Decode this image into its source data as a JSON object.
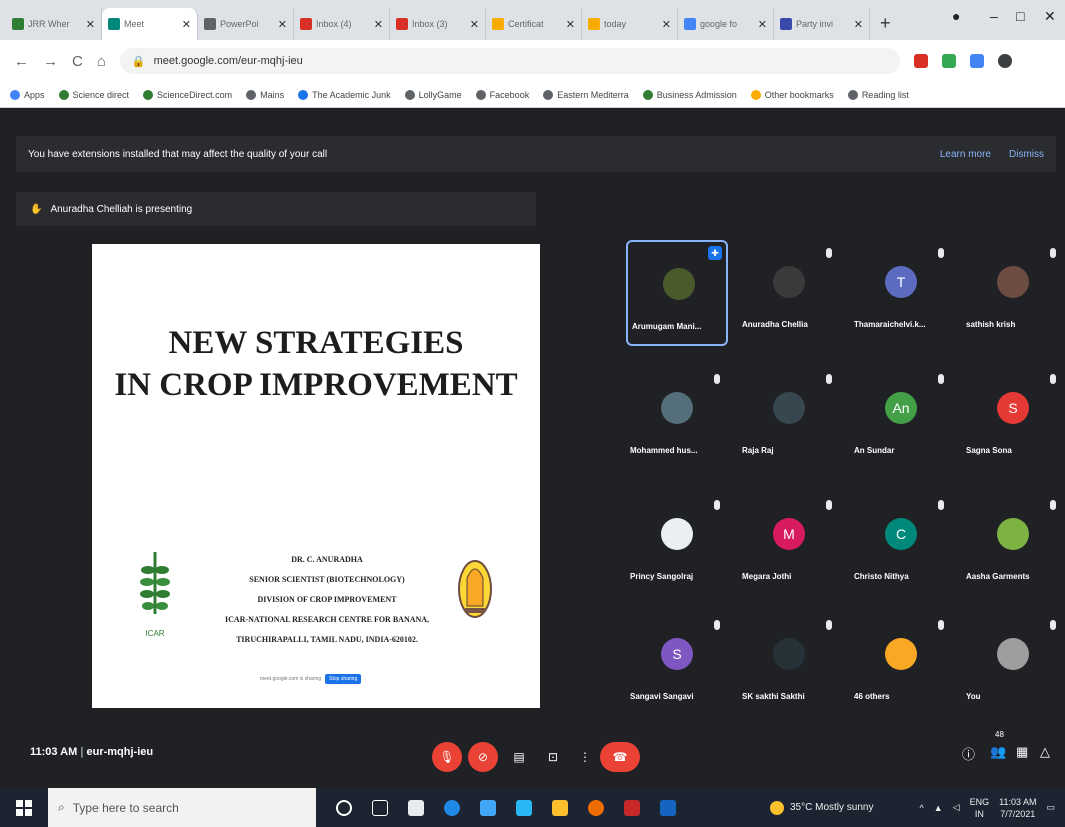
{
  "browser": {
    "tabs": [
      {
        "title": "JRR Wher",
        "color": "#2e7d32"
      },
      {
        "title": "Meet",
        "color": "#00897b",
        "active": true
      },
      {
        "title": "PowerPoi",
        "color": "#5f6368"
      },
      {
        "title": "Inbox (4)",
        "color": "#d93025"
      },
      {
        "title": "Inbox (3)",
        "color": "#d93025"
      },
      {
        "title": "Certificat",
        "color": "#f9ab00"
      },
      {
        "title": "today",
        "color": "#f9ab00"
      },
      {
        "title": "google fo",
        "color": "#4285f4"
      },
      {
        "title": "Party invi",
        "color": "#3949ab"
      }
    ],
    "url": "meet.google.com/eur-mqhj-ieu",
    "bookmarks": [
      "Apps",
      "Science direct",
      "ScienceDirect.com",
      "Mains",
      "The Academic Junk",
      "LollyGame",
      "Facebook",
      "Eastern Mediterra",
      "Business Admission",
      "Other bookmarks",
      "Reading list"
    ]
  },
  "meet": {
    "banner_text": "You have extensions installed that may affect the quality of your call",
    "learn_more": "Learn more",
    "dismiss": "Dismiss",
    "presenting_text": "Anuradha Chelliah is presenting",
    "slide": {
      "title_line1": "NEW STRATEGIES",
      "title_line2": "IN CROP IMPROVEMENT",
      "author_lines": [
        "DR. C. ANURADHA",
        "SENIOR SCIENTIST (BIOTECHNOLOGY)",
        "DIVISION OF CROP IMPROVEMENT",
        "ICAR-NATIONAL RESEARCH CENTRE FOR BANANA,",
        "TIRUCHIRAPALLI, TAMIL NADU, INDIA-620102."
      ],
      "share_bar_text": "meet.google.com is sharing",
      "stop_label": "Stop sharing",
      "icar_label": "ICAR"
    },
    "participants": [
      {
        "name": "Arumugam Mani...",
        "initial": "",
        "color": "#4a5a2a"
      },
      {
        "name": "Anuradha Chellia",
        "initial": "",
        "color": "#3a3a3a"
      },
      {
        "name": "Thamaraichelvi.k...",
        "initial": "T",
        "color": "#5c6bc0"
      },
      {
        "name": "sathish krish",
        "initial": "",
        "color": "#6d4c41"
      },
      {
        "name": "Mohammed hus...",
        "initial": "",
        "color": "#546e7a"
      },
      {
        "name": "Raja Raj",
        "initial": "",
        "color": "#37474f"
      },
      {
        "name": "An Sundar",
        "initial": "An",
        "color": "#43a047"
      },
      {
        "name": "Sagna Sona",
        "initial": "S",
        "color": "#e53935"
      },
      {
        "name": "Princy Sangolraj",
        "initial": "",
        "color": "#eceff1"
      },
      {
        "name": "Megara Jothi",
        "initial": "M",
        "color": "#d81b60"
      },
      {
        "name": "Christo Nithya",
        "initial": "C",
        "color": "#00897b"
      },
      {
        "name": "Aasha Garments",
        "initial": "",
        "color": "#7cb342"
      },
      {
        "name": "Sangavi Sangavi",
        "initial": "S",
        "color": "#7e57c2"
      },
      {
        "name": "SK sakthi Sakthi",
        "initial": "",
        "color": "#263238"
      },
      {
        "name": "46 others",
        "initial": "",
        "color": "#f9a825"
      },
      {
        "name": "You",
        "initial": "",
        "color": "#9e9e9e"
      }
    ],
    "time": "11:03 AM",
    "meeting_code": "eur-mqhj-ieu",
    "participant_count": "48"
  },
  "taskbar": {
    "search_placeholder": "Type here to search",
    "weather": "35°C Mostly sunny",
    "lang": "ENG",
    "lang2": "IN",
    "time": "11:03 AM",
    "date": "7/7/2021"
  }
}
